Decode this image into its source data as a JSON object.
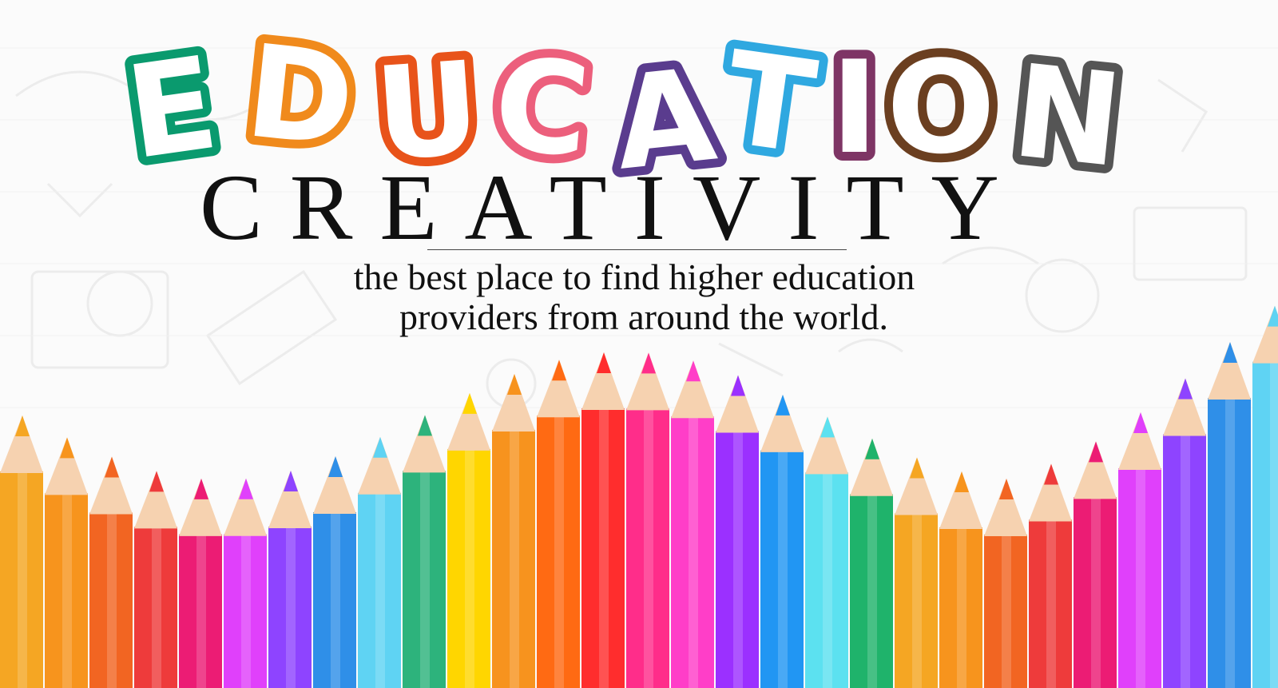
{
  "logo": {
    "letters": [
      {
        "char": "E",
        "color": "#0a9a6e"
      },
      {
        "char": "D",
        "color": "#f08a1c"
      },
      {
        "char": "U",
        "color": "#e8531a"
      },
      {
        "char": "C",
        "color": "#ec5f7c"
      },
      {
        "char": "A",
        "color": "#5a3c8e"
      },
      {
        "char": "T",
        "color": "#2fa8e0"
      },
      {
        "char": "I",
        "color": "#7e3565"
      },
      {
        "char": "O",
        "color": "#6b3f20"
      },
      {
        "char": "N",
        "color": "#555555"
      }
    ]
  },
  "tagline": "CREATIVITY",
  "subtitle": {
    "line1": "the best place to find higher education",
    "line2": "providers from around the world."
  },
  "pencil_colors": [
    "#f5a623",
    "#f7941d",
    "#f26522",
    "#ee3b3b",
    "#ec1c74",
    "#e040fb",
    "#8e44ff",
    "#2f8fe8",
    "#5fd3f3",
    "#2db37c",
    "#ffd600",
    "#f7931e",
    "#ff6a13",
    "#ff2d2d",
    "#ff2d8a",
    "#ff3ec8",
    "#9b30ff",
    "#2196f3",
    "#5ce1f0",
    "#1fb36b"
  ]
}
